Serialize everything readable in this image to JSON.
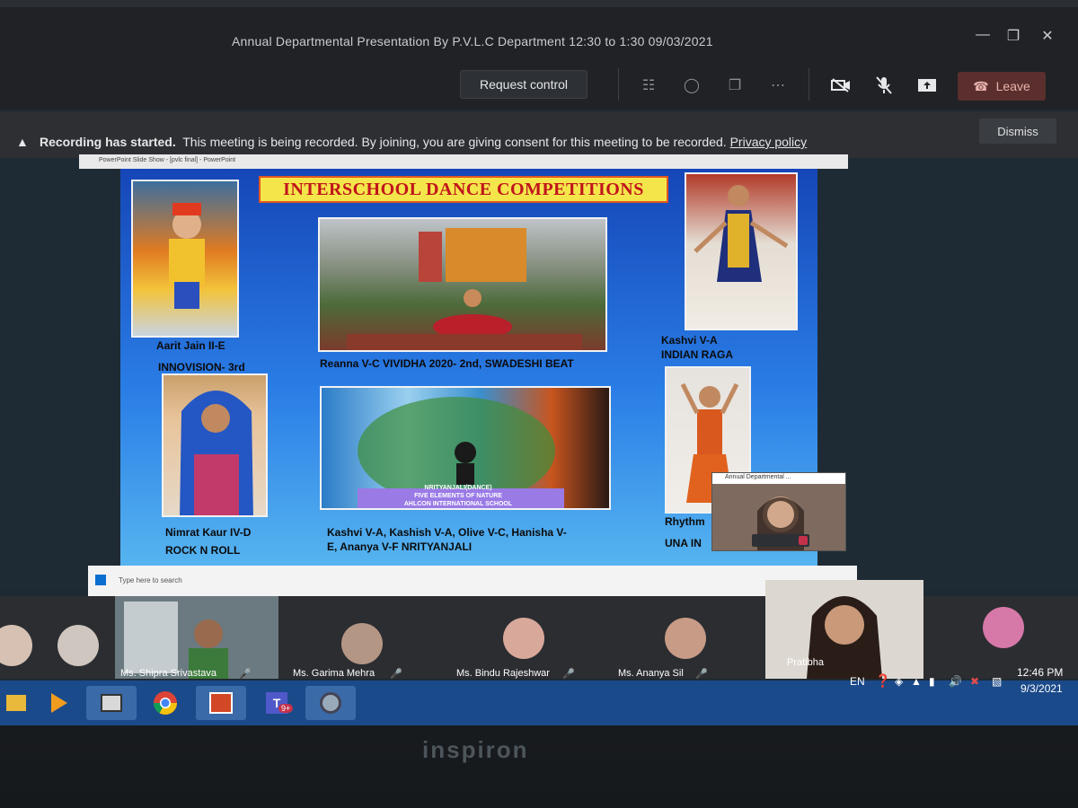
{
  "meeting": {
    "title": "Annual Departmental Presentation By P.V.L.C Department 12:30 to 1:30 09/03/2021"
  },
  "toolbar": {
    "request_control": "Request control",
    "leave": "Leave"
  },
  "recording_banner": {
    "heading": "Recording has started.",
    "message": "This meeting is being recorded. By joining, you are giving consent for this meeting to be recorded.",
    "link": "Privacy policy",
    "dismiss": "Dismiss"
  },
  "slide": {
    "window_title": "PowerPoint Slide Show - [pvlc final] - PowerPoint",
    "banner": "INTERSCHOOL DANCE COMPETITIONS",
    "captions": {
      "aarit_name": "Aarit Jain II-E",
      "aarit_event": "INNOVISION- 3rd",
      "reanna": "Reanna V-C VIVIDHA 2020- 2nd, SWADESHI BEAT",
      "kashvi_name": "Kashvi V-A",
      "kashvi_event": "INDIAN RAGA",
      "nimrat_name": "Nimrat Kaur IV-D",
      "nimrat_event": "ROCK N ROLL",
      "group_line1": "Kashvi V-A, Kashish V-A, Olive V-C, Hanisha V-",
      "group_line2": "E, Ananya V-F NRITYANJALI",
      "rhythm": "Rhythm",
      "una": "UNA IN"
    },
    "poster_text": [
      "NRITYANJALI(DANCE)",
      "FIVE ELEMENTS OF NATURE",
      "AHLCON INTERNATIONAL SCHOOL"
    ]
  },
  "inner_taskbar": {
    "search_placeholder": "Type here to search",
    "mini_window_title": "Annual Departmental ..."
  },
  "participants": [
    {
      "name": "Ms. Shipra Srivastava"
    },
    {
      "name": "Ms. Garima Mehra"
    },
    {
      "name": "Ms. Bindu Rajeshwar"
    },
    {
      "name": "Ms. Ananya Sil"
    },
    {
      "name": "Pratibha"
    }
  ],
  "system_tray": {
    "language": "EN",
    "time": "12:46 PM",
    "date": "9/3/2021",
    "teams_badge": "9+"
  },
  "laptop": {
    "brand": "inspiron"
  },
  "colors": {
    "leave_bg": "#5a2f2d",
    "slide_top": "#1546b8",
    "banner_bg": "#f4e64a",
    "banner_text": "#c0151b",
    "taskbar": "#1b4a8a"
  }
}
